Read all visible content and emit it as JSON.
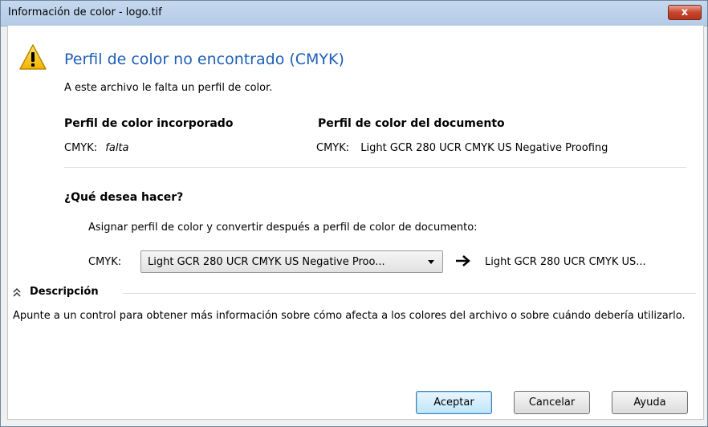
{
  "window": {
    "title": "Información de color - logo.tif",
    "close_label": "x"
  },
  "header": {
    "icon": "warning-triangle-icon",
    "heading": "Perfil de color no encontrado (CMYK)",
    "subtext": "A este archivo le falta un perfil de color."
  },
  "embedded": {
    "label": "Perfil de color incorporado",
    "mode": "CMYK:",
    "value": "falta"
  },
  "document": {
    "label": "Perfil de color del documento",
    "mode": "CMYK:",
    "value": "Light GCR 280 UCR CMYK US Negative Proofing"
  },
  "action": {
    "question": "¿Qué desea hacer?",
    "assign_text": "Asignar perfil de color y convertir después a perfil de color de documento:",
    "mode_label": "CMYK:",
    "selected_profile": "Light GCR 280 UCR CMYK US Negative Proo...",
    "arrow_icon": "arrow-right-icon",
    "target_profile": "Light GCR 280 UCR CMYK US..."
  },
  "description": {
    "toggle_icon": "double-chevron-up-icon",
    "heading": "Descripción",
    "text": "Apunte a un control para obtener más información sobre cómo afecta a los colores del archivo o sobre cuándo debería utilizarlo."
  },
  "buttons": {
    "ok": "Aceptar",
    "cancel": "Cancelar",
    "help": "Ayuda"
  },
  "colors": {
    "heading_blue": "#1e5eb8",
    "close_red": "#c9452d",
    "title_bar": "#c5d8ee"
  }
}
